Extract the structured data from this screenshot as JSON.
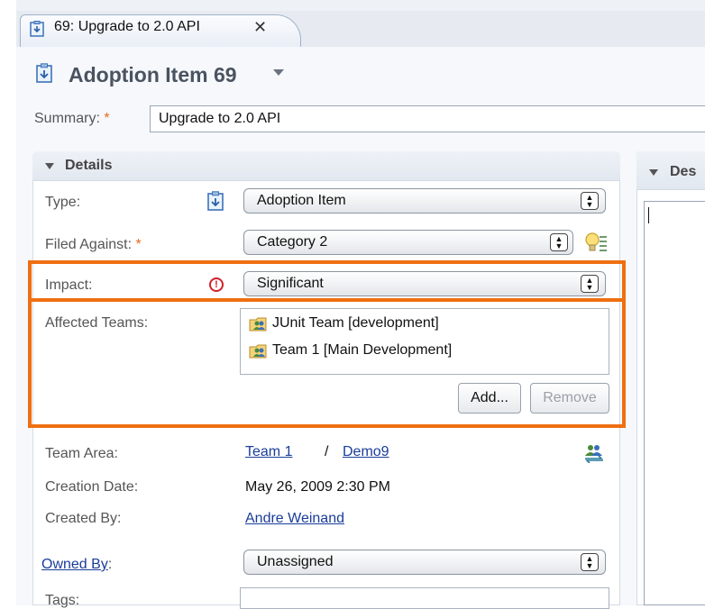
{
  "tab": {
    "label": "69: Upgrade to 2.0 API",
    "close_glyph": "✕"
  },
  "header": {
    "title": "Adoption Item 69"
  },
  "summary": {
    "label": "Summary:",
    "required_mark": "*",
    "value": "Upgrade to 2.0 API"
  },
  "details": {
    "title": "Details",
    "type": {
      "label": "Type:",
      "value": "Adoption Item"
    },
    "filed_against": {
      "label": "Filed Against:",
      "required_mark": "*",
      "value": "Category 2"
    },
    "impact": {
      "label": "Impact:",
      "value": "Significant",
      "icon_glyph": "!"
    },
    "affected_teams": {
      "label": "Affected Teams:",
      "items": [
        "JUnit Team [development]",
        "Team 1 [Main Development]"
      ],
      "add_label": "Add...",
      "remove_label": "Remove"
    },
    "team_area": {
      "label": "Team Area:",
      "team_link": "Team 1",
      "separator": "/",
      "project_link": "Demo9"
    },
    "creation_date": {
      "label": "Creation Date:",
      "value": "May 26, 2009 2:30 PM"
    },
    "created_by": {
      "label": "Created By:",
      "value": "Andre Weinand"
    },
    "owned_by": {
      "label": "Owned By",
      "suffix": ":",
      "value": "Unassigned"
    },
    "tags": {
      "label": "Tags:"
    }
  },
  "description": {
    "title": "Des"
  },
  "colors": {
    "highlight": "#ef6f12",
    "required": "#e46a1c",
    "link": "#1a3d9a",
    "error": "#d0202a"
  },
  "icons": [
    "work-item-icon",
    "close-icon",
    "lightbulb-icon",
    "error-icon",
    "team-icon",
    "team-area-icon"
  ]
}
